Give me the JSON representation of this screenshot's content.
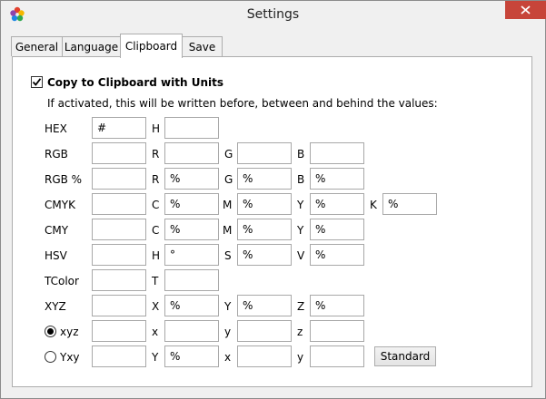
{
  "window": {
    "title": "Settings",
    "close_icon": "close-x-icon",
    "app_icon": "palette-icon"
  },
  "tabs": [
    {
      "label": "General",
      "active": false
    },
    {
      "label": "Language",
      "active": false
    },
    {
      "label": "Clipboard",
      "active": true
    },
    {
      "label": "Save",
      "active": false
    }
  ],
  "clipboard": {
    "checkbox_label": "Copy to Clipboard with Units",
    "checkbox_checked": true,
    "description": "If activated, this will be written before, between and behind the values:",
    "rows": {
      "hex": {
        "label": "HEX",
        "prefix": "#",
        "c1_label": "H",
        "c1": ""
      },
      "rgb": {
        "label": "RGB",
        "prefix": "",
        "c1_label": "R",
        "c1": "",
        "c2_label": "G",
        "c2": "",
        "c3_label": "B",
        "c3": ""
      },
      "rgbp": {
        "label": "RGB %",
        "prefix": "",
        "c1_label": "R",
        "c1": "%",
        "c2_label": "G",
        "c2": "%",
        "c3_label": "B",
        "c3": "%"
      },
      "cmyk": {
        "label": "CMYK",
        "prefix": "",
        "c1_label": "C",
        "c1": "%",
        "c2_label": "M",
        "c2": "%",
        "c3_label": "Y",
        "c3": "%",
        "c4_label": "K",
        "c4": "%"
      },
      "cmy": {
        "label": "CMY",
        "prefix": "",
        "c1_label": "C",
        "c1": "%",
        "c2_label": "M",
        "c2": "%",
        "c3_label": "Y",
        "c3": "%"
      },
      "hsv": {
        "label": "HSV",
        "prefix": "",
        "c1_label": "H",
        "c1": "°",
        "c2_label": "S",
        "c2": "%",
        "c3_label": "V",
        "c3": "%"
      },
      "tcolor": {
        "label": "TColor",
        "prefix": "",
        "c1_label": "T",
        "c1": ""
      },
      "xyz": {
        "label": "XYZ",
        "prefix": "",
        "c1_label": "X",
        "c1": "%",
        "c2_label": "Y",
        "c2": "%",
        "c3_label": "Z",
        "c3": "%"
      },
      "xyz_lower": {
        "label": "xyz",
        "selected": true,
        "prefix": "",
        "c1_label": "x",
        "c1": "",
        "c2_label": "y",
        "c2": "",
        "c3_label": "z",
        "c3": ""
      },
      "yxy": {
        "label": "Yxy",
        "selected": false,
        "prefix": "",
        "c1_label": "Y",
        "c1": "%",
        "c2_label": "x",
        "c2": "",
        "c3_label": "y",
        "c3": ""
      }
    },
    "standard_button": "Standard"
  }
}
